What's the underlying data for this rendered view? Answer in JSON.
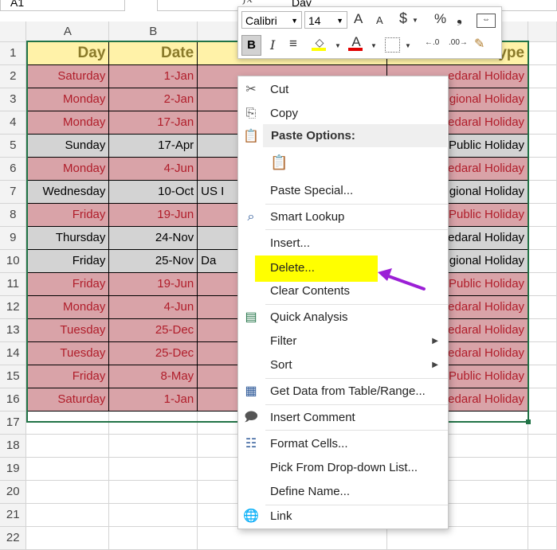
{
  "namebox": "A1",
  "formula": "Day",
  "columns": [
    "A",
    "B"
  ],
  "rows": [
    {
      "n": "1",
      "day": "Day",
      "date": "Date",
      "c": "",
      "e": "ype",
      "style": "hdr"
    },
    {
      "n": "2",
      "day": "Saturday",
      "date": "1-Jan",
      "c": "",
      "e": "edaral Holiday",
      "style": "pink"
    },
    {
      "n": "3",
      "day": "Monday",
      "date": "2-Jan",
      "c": "",
      "e": "gional Holiday",
      "style": "pink"
    },
    {
      "n": "4",
      "day": "Monday",
      "date": "17-Jan",
      "c": "",
      "e": "edaral Holiday",
      "style": "pink"
    },
    {
      "n": "5",
      "day": "Sunday",
      "date": "17-Apr",
      "c": "",
      "e": "Public Holiday",
      "style": "gray"
    },
    {
      "n": "6",
      "day": "Monday",
      "date": "4-Jun",
      "c": "",
      "e": "edaral Holiday",
      "style": "pink"
    },
    {
      "n": "7",
      "day": "Wednesday",
      "date": "10-Oct",
      "c": "US I",
      "e": "gional Holiday",
      "style": "gray"
    },
    {
      "n": "8",
      "day": "Friday",
      "date": "19-Jun",
      "c": "",
      "e": "Public Holiday",
      "style": "pink"
    },
    {
      "n": "9",
      "day": "Thursday",
      "date": "24-Nov",
      "c": "",
      "e": "edaral Holiday",
      "style": "gray"
    },
    {
      "n": "10",
      "day": "Friday",
      "date": "25-Nov",
      "c": "Da",
      "e": "gional Holiday",
      "style": "gray"
    },
    {
      "n": "11",
      "day": "Friday",
      "date": "19-Jun",
      "c": "",
      "e": "Public Holiday",
      "style": "pink"
    },
    {
      "n": "12",
      "day": "Monday",
      "date": "4-Jun",
      "c": "",
      "e": "edaral Holiday",
      "style": "pink"
    },
    {
      "n": "13",
      "day": "Tuesday",
      "date": "25-Dec",
      "c": "",
      "e": "edaral Holiday",
      "style": "pink"
    },
    {
      "n": "14",
      "day": "Tuesday",
      "date": "25-Dec",
      "c": "",
      "e": "edaral Holiday",
      "style": "pink"
    },
    {
      "n": "15",
      "day": "Friday",
      "date": "8-May",
      "c": "",
      "e": "Public Holiday",
      "style": "pink"
    },
    {
      "n": "16",
      "day": "Saturday",
      "date": "1-Jan",
      "c": "",
      "e": "edaral Holiday",
      "style": "pink"
    },
    {
      "n": "17",
      "style": "empty"
    },
    {
      "n": "18",
      "style": "empty"
    },
    {
      "n": "19",
      "style": "empty"
    },
    {
      "n": "20",
      "style": "empty"
    },
    {
      "n": "21",
      "style": "empty"
    },
    {
      "n": "22",
      "style": "empty"
    }
  ],
  "mini_toolbar": {
    "font": "Calibri",
    "size": "14",
    "grow": "A",
    "shrink": "A",
    "currency": "$",
    "percent": "%",
    "comma": "❟",
    "bold": "B",
    "italic": "I",
    "font_color_letter": "A",
    "fill_color": "#ffff00",
    "font_color": "#e00000"
  },
  "context_menu": {
    "cut": "Cut",
    "copy": "Copy",
    "paste_options": "Paste Options:",
    "paste_special": "Paste Special...",
    "smart_lookup": "Smart Lookup",
    "insert": "Insert...",
    "delete": "Delete...",
    "clear_contents": "Clear Contents",
    "quick_analysis": "Quick Analysis",
    "filter": "Filter",
    "sort": "Sort",
    "get_data": "Get Data from Table/Range...",
    "insert_comment": "Insert Comment",
    "format_cells": "Format Cells...",
    "pick_dropdown": "Pick From Drop-down List...",
    "define_name": "Define Name...",
    "link": "Link"
  },
  "colors": {
    "header_fill": "#fff2a8",
    "pink_fill": "#d9a3a8",
    "gray_fill": "#d3d3d3",
    "red_text": "#b01d2a",
    "highlight": "#ffff00",
    "arrow": "#9b1fd6",
    "selection": "#217346"
  }
}
